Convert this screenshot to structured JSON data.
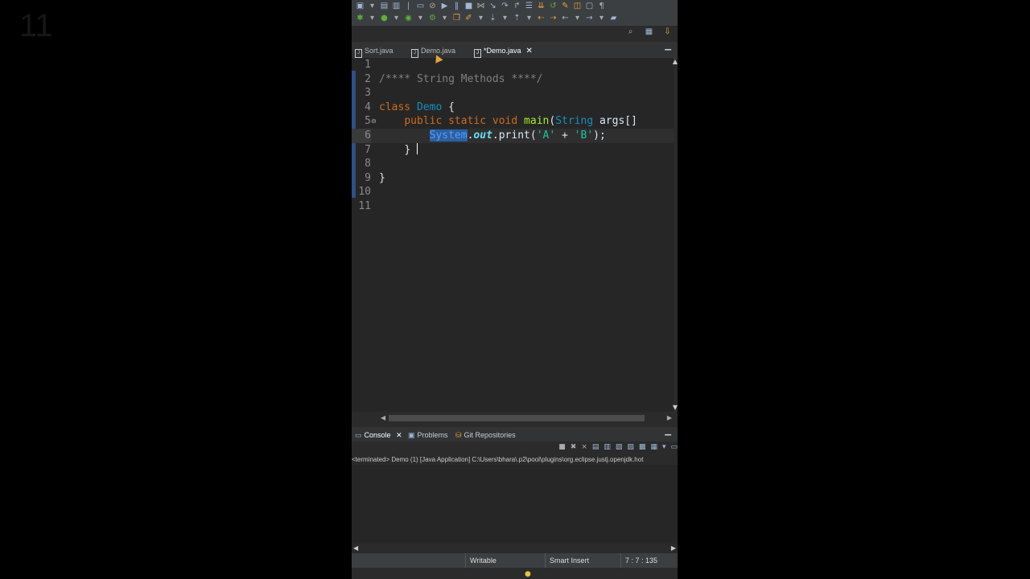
{
  "background_number": "11",
  "tabs": [
    {
      "label": "Sort.java"
    },
    {
      "label": "Demo.java"
    },
    {
      "label": "*Demo.java",
      "close": "✕"
    }
  ],
  "editor": {
    "line_numbers": [
      "1",
      "2",
      "3",
      "4",
      "5",
      "6",
      "7",
      "8",
      "9",
      "10",
      "11"
    ],
    "comment": "/**** String Methods ****/",
    "kw_class": "class",
    "class_name": "Demo",
    "brace_open": " {",
    "kw_public": "public",
    "kw_static": "static",
    "kw_void": "void",
    "method_main": "main",
    "paren_open": "(",
    "type_string": "String",
    "args": "args[]",
    "system": "System",
    "dot1": ".",
    "out": "out",
    "dot2": ".",
    "print": "print",
    "print_open": "(",
    "char_a": "'A'",
    "plus": " + ",
    "char_b": "'B'",
    "print_close": ");",
    "inner_close": "}",
    "outer_close": "}"
  },
  "console": {
    "tabs": [
      {
        "label": "Console",
        "close": "✕"
      },
      {
        "label": "Problems"
      },
      {
        "label": "Git Repositories"
      }
    ],
    "header": "<terminated> Demo (1) [Java Application] C:\\Users\\bhara\\.p2\\pool\\plugins\\org.eclipse.justj.openjdk.hot"
  },
  "status": {
    "writable": "Writable",
    "insert_mode": "Smart Insert",
    "position": "7 : 7 : 135"
  },
  "colors": {
    "keyword": "#cc6c1d",
    "class": "#1290c3",
    "comment": "#808080",
    "method": "#a7ec21",
    "string": "#17c6a3",
    "field": "#66e1f8",
    "selection": "#2e5ea0"
  },
  "icons": [
    "new-icon",
    "save-icon",
    "run-icon",
    "debug-icon",
    "search-icon",
    "perspective-icon",
    "close-icon",
    "lightbulb-icon"
  ]
}
